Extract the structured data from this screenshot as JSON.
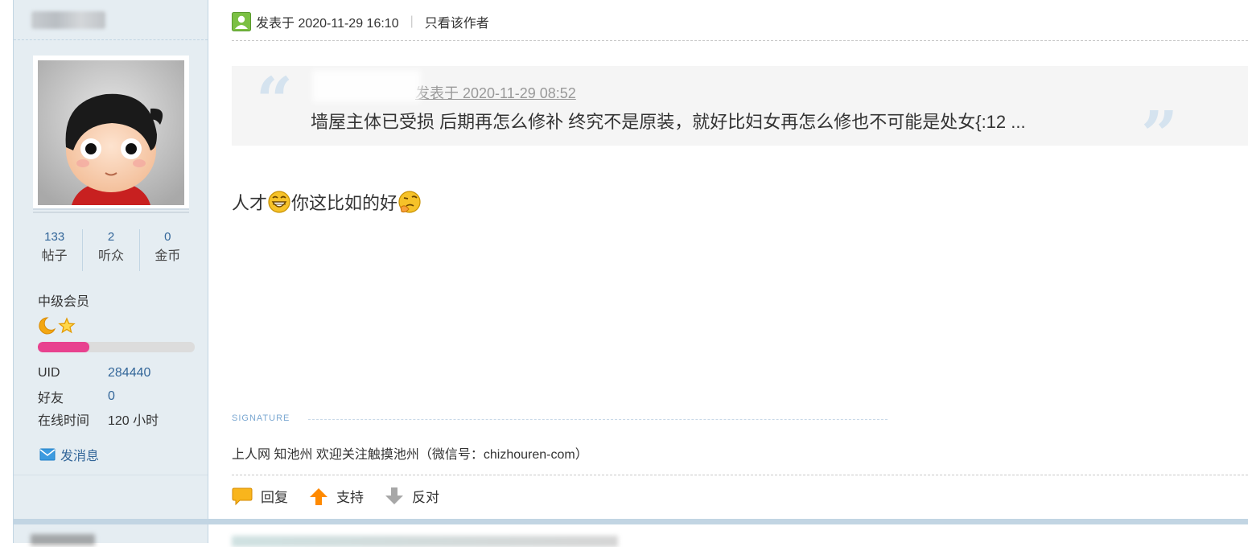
{
  "author": {
    "stats": [
      {
        "value": "133",
        "label": "帖子"
      },
      {
        "value": "2",
        "label": "听众"
      },
      {
        "value": "0",
        "label": "金币"
      }
    ],
    "group": "中级会员",
    "level_progress": 0.33,
    "info": [
      {
        "key": "UID",
        "value": "284440"
      },
      {
        "key": "好友",
        "value": "0"
      },
      {
        "key": "在线时间",
        "value": "120 小时"
      }
    ],
    "send_message": "发消息"
  },
  "post": {
    "posted_label": "发表于 2020-11-29 16:10",
    "only_author": "只看该作者",
    "quote": {
      "meta": "发表于 2020-11-29 08:52",
      "text": "墙屋主体已受损 后期再怎么修补 终究不是原装，就好比妇女再怎么修也不可能是处女{:12 ..."
    },
    "body": {
      "part1": "人才",
      "part2": "你这比如的好"
    },
    "signature_label": "SIGNATURE",
    "signature": "上人网 知池州 欢迎关注触摸池州（微信号：chizhouren-com）",
    "actions": {
      "reply": "回复",
      "support": "支持",
      "oppose": "反对"
    }
  },
  "colors": {
    "sidebar_bg": "#e5edf2",
    "link": "#336699",
    "progress": "#e8428f"
  }
}
